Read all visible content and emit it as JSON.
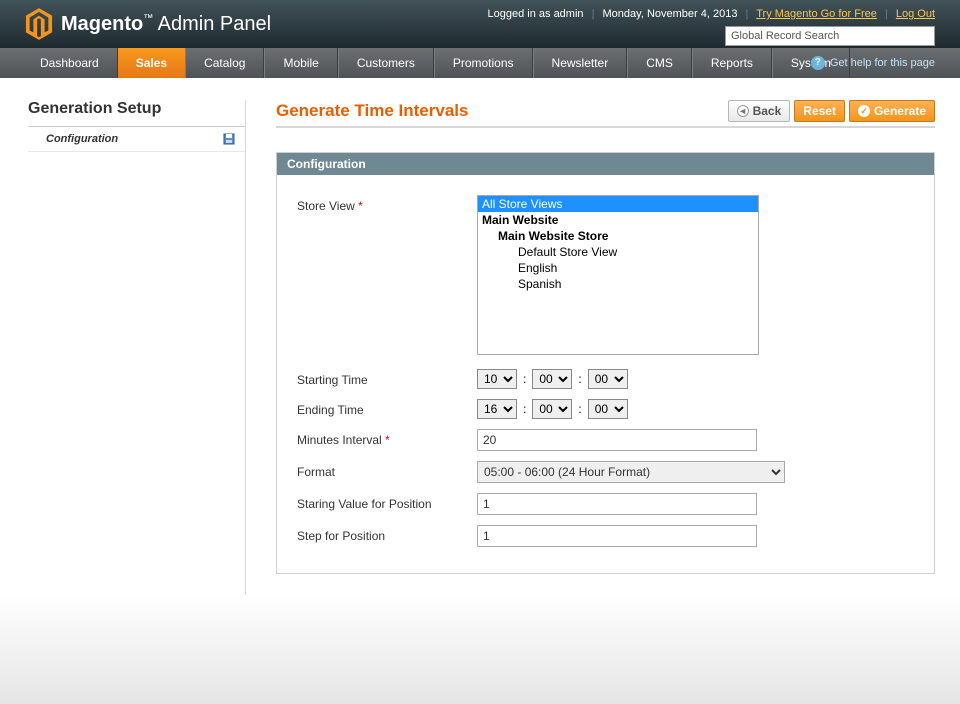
{
  "header": {
    "brand_main": "Magento",
    "brand_sub": "Admin Panel",
    "logged_in": "Logged in as admin",
    "date": "Monday, November 4, 2013",
    "try_link": "Try Magento Go for Free",
    "logout": "Log Out",
    "search_placeholder": "Global Record Search"
  },
  "nav": {
    "items": [
      "Dashboard",
      "Sales",
      "Catalog",
      "Mobile",
      "Customers",
      "Promotions",
      "Newsletter",
      "CMS",
      "Reports",
      "System"
    ],
    "active": "Sales",
    "help": "Get help for this page"
  },
  "sidebar": {
    "title": "Generation Setup",
    "item": "Configuration"
  },
  "page": {
    "title": "Generate Time Intervals",
    "btn_back": "Back",
    "btn_reset": "Reset",
    "btn_generate": "Generate"
  },
  "panel": {
    "title": "Configuration",
    "labels": {
      "store_view": "Store View",
      "starting_time": "Starting Time",
      "ending_time": "Ending Time",
      "minutes_interval": "Minutes Interval",
      "format": "Format",
      "start_val": "Staring Value for Position",
      "step": "Step for Position"
    },
    "store_options": {
      "all": "All Store Views",
      "website": "Main Website",
      "store": "Main Website Store",
      "views": [
        "Default Store View",
        "English",
        "Spanish"
      ]
    },
    "values": {
      "start_hour": "10",
      "start_min": "00",
      "start_sec": "00",
      "end_hour": "16",
      "end_min": "00",
      "end_sec": "00",
      "minutes_interval": "20",
      "format_selected": "05:00 - 06:00 (24 Hour Format)",
      "start_val": "1",
      "step": "1",
      "colon": ":"
    }
  }
}
